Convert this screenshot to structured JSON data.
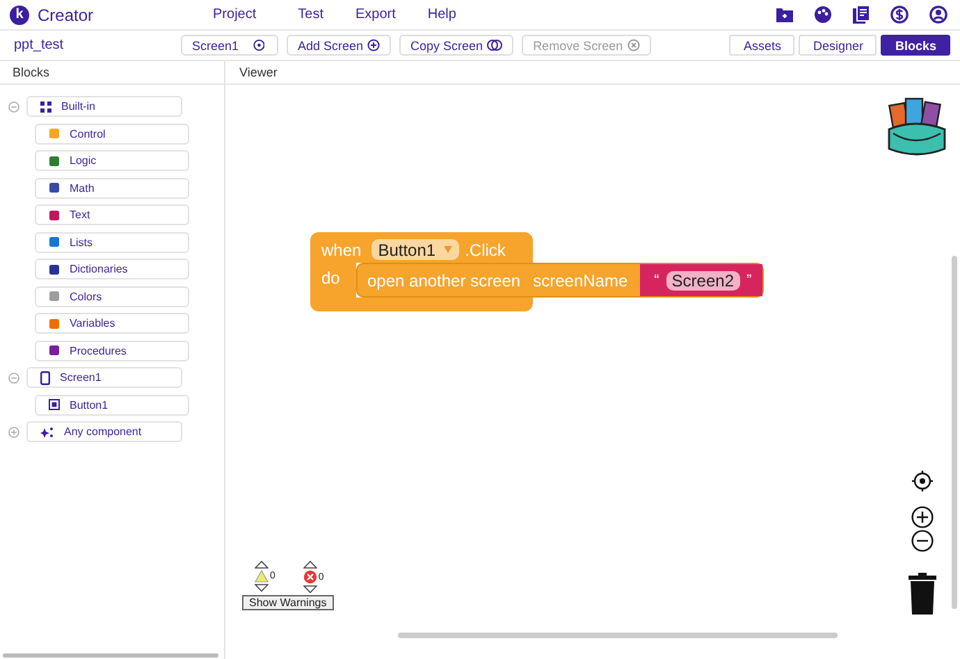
{
  "app": {
    "title": "Creator",
    "logo_letter": "k"
  },
  "menu": [
    "Project",
    "Test",
    "Export",
    "Help"
  ],
  "toolbar": {
    "project_name": "ppt_test",
    "screen_buttons": [
      {
        "label": "Screen1",
        "kind": "dropdown",
        "disabled": false
      },
      {
        "label": "Add Screen",
        "kind": "add",
        "disabled": false
      },
      {
        "label": "Copy Screen",
        "kind": "copy",
        "disabled": false
      },
      {
        "label": "Remove Screen",
        "kind": "remove",
        "disabled": true
      }
    ],
    "view_tabs": [
      {
        "label": "Assets",
        "selected": false
      },
      {
        "label": "Designer",
        "selected": false
      },
      {
        "label": "Blocks",
        "selected": true
      }
    ]
  },
  "blocks_panel": {
    "title": "Blocks",
    "tree": [
      {
        "label": "Built-in",
        "expanded": true,
        "children": [
          {
            "label": "Control"
          },
          {
            "label": "Logic"
          },
          {
            "label": "Math"
          },
          {
            "label": "Text"
          },
          {
            "label": "Lists"
          },
          {
            "label": "Dictionaries"
          },
          {
            "label": "Colors"
          },
          {
            "label": "Variables"
          },
          {
            "label": "Procedures"
          }
        ]
      },
      {
        "label": "Screen1",
        "expanded": true,
        "children": [
          {
            "label": "Button1"
          }
        ]
      },
      {
        "label": "Any component",
        "expanded": false
      }
    ]
  },
  "viewer": {
    "title": "Viewer",
    "event_block": {
      "when": "when",
      "component": "Button1",
      "event": ".Click",
      "do": "do",
      "statement": "open another screen",
      "param": "screenName",
      "open_quote": "“",
      "value": "Screen2",
      "close_quote": "”"
    },
    "warnings": {
      "count": "0"
    },
    "errors": {
      "count": "0"
    },
    "toggle_button": "Show Warnings"
  }
}
